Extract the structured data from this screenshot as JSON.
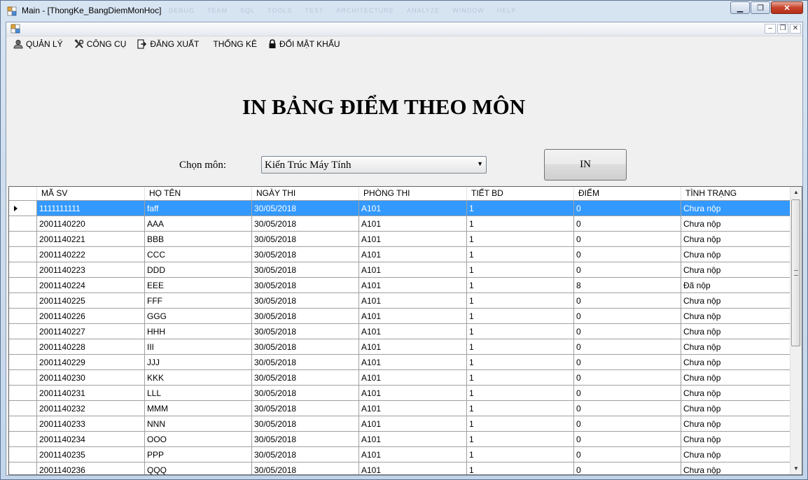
{
  "window": {
    "title": "Main - [ThongKe_BangDiemMonHoc]"
  },
  "ghost_menu": [
    "DEBUG",
    "TEAM",
    "SQL",
    "TOOLS",
    "TEST",
    "ARCHITECTURE",
    "ANALYZE",
    "WINDOW",
    "HELP"
  ],
  "menu": [
    {
      "label": "QUẢN LÝ",
      "icon": "user-icon"
    },
    {
      "label": "CÔNG CỤ",
      "icon": "tools-icon"
    },
    {
      "label": "ĐĂNG XUẤT",
      "icon": "logout-icon"
    },
    {
      "label": "THỐNG KÊ",
      "icon": ""
    },
    {
      "label": "ĐỔI MẬT KHẨU",
      "icon": "lock-icon"
    }
  ],
  "form": {
    "title": "IN BẢNG ĐIỂM THEO MÔN",
    "subject_label": "Chọn môn:",
    "subject_value": "Kiến Trúc Máy Tính",
    "print_button": "IN"
  },
  "table": {
    "columns": [
      "MÃ SV",
      "HỌ TÊN",
      "NGÀY THI",
      "PHÒNG THI",
      "TIẾT BD",
      "ĐIỂM",
      "TÌNH TRẠNG"
    ],
    "rows": [
      [
        "1111111111",
        "faff",
        "30/05/2018",
        "A101",
        "1",
        "0",
        "Chưa nộp"
      ],
      [
        "2001140220",
        "AAA",
        "30/05/2018",
        "A101",
        "1",
        "0",
        "Chưa nộp"
      ],
      [
        "2001140221",
        "BBB",
        "30/05/2018",
        "A101",
        "1",
        "0",
        "Chưa nộp"
      ],
      [
        "2001140222",
        "CCC",
        "30/05/2018",
        "A101",
        "1",
        "0",
        "Chưa nộp"
      ],
      [
        "2001140223",
        "DDD",
        "30/05/2018",
        "A101",
        "1",
        "0",
        "Chưa nộp"
      ],
      [
        "2001140224",
        "EEE",
        "30/05/2018",
        "A101",
        "1",
        "8",
        "Đã nộp"
      ],
      [
        "2001140225",
        "FFF",
        "30/05/2018",
        "A101",
        "1",
        "0",
        "Chưa nộp"
      ],
      [
        "2001140226",
        "GGG",
        "30/05/2018",
        "A101",
        "1",
        "0",
        "Chưa nộp"
      ],
      [
        "2001140227",
        "HHH",
        "30/05/2018",
        "A101",
        "1",
        "0",
        "Chưa nộp"
      ],
      [
        "2001140228",
        "III",
        "30/05/2018",
        "A101",
        "1",
        "0",
        "Chưa nộp"
      ],
      [
        "2001140229",
        "JJJ",
        "30/05/2018",
        "A101",
        "1",
        "0",
        "Chưa nộp"
      ],
      [
        "2001140230",
        "KKK",
        "30/05/2018",
        "A101",
        "1",
        "0",
        "Chưa nộp"
      ],
      [
        "2001140231",
        "LLL",
        "30/05/2018",
        "A101",
        "1",
        "0",
        "Chưa nộp"
      ],
      [
        "2001140232",
        "MMM",
        "30/05/2018",
        "A101",
        "1",
        "0",
        "Chưa nộp"
      ],
      [
        "2001140233",
        "NNN",
        "30/05/2018",
        "A101",
        "1",
        "0",
        "Chưa nộp"
      ],
      [
        "2001140234",
        "OOO",
        "30/05/2018",
        "A101",
        "1",
        "0",
        "Chưa nộp"
      ],
      [
        "2001140235",
        "PPP",
        "30/05/2018",
        "A101",
        "1",
        "0",
        "Chưa nộp"
      ],
      [
        "2001140236",
        "QQQ",
        "30/05/2018",
        "A101",
        "1",
        "0",
        "Chưa nộp"
      ]
    ],
    "selected_row": 0
  },
  "colors": {
    "selection": "#3399ff",
    "close_button": "#c7432b"
  }
}
